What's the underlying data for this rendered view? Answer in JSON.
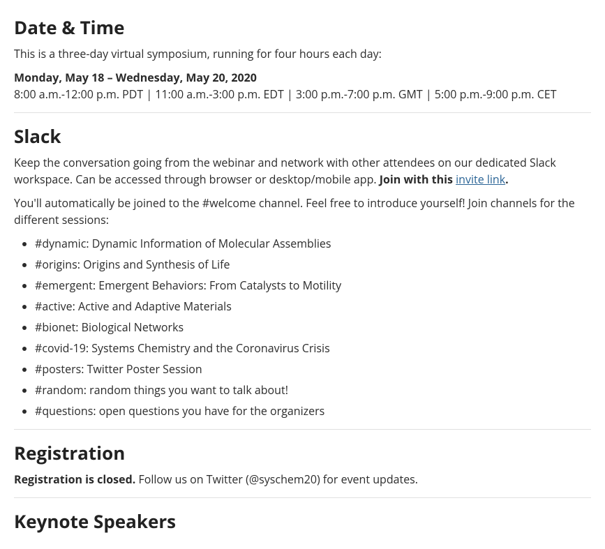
{
  "dateTime": {
    "heading": "Date & Time",
    "intro": "This is a three-day virtual symposium, running for four hours each day:",
    "dates": "Monday, May 18 – Wednesday, May 20, 2020",
    "times": "8:00 a.m.-12:00 p.m. PDT | 11:00 a.m.-3:00 p.m. EDT | 3:00 p.m.-7:00 p.m. GMT | 5:00 p.m.-9:00 p.m. CET"
  },
  "slack": {
    "heading": "Slack",
    "para1a": "Keep the conversation going from the webinar and network with other attendees on our dedicated Slack workspace. Can be accessed through browser or desktop/mobile app. ",
    "para1b": "Join with this ",
    "linkText": "invite link",
    "period": ".",
    "para2": "You'll automatically be joined to the #welcome channel. Feel free to introduce yourself! Join channels for the different sessions:",
    "channels": [
      "#dynamic: Dynamic Information of Molecular Assemblies",
      "#origins: Origins and Synthesis of Life",
      "#emergent: Emergent Behaviors: From Catalysts to Motility",
      "#active: Active and Adaptive Materials",
      "#bionet: Biological Networks",
      "#covid-19: Systems Chemistry and the Coronavirus Crisis",
      "#posters: Twitter Poster Session",
      "#random: random things you want to talk about!",
      "#questions: open questions you have for the organizers"
    ]
  },
  "registration": {
    "heading": "Registration",
    "closed": "Registration is closed.",
    "follow": " Follow us on Twitter (@syschem20) for event updates."
  },
  "keynote": {
    "heading": "Keynote Speakers"
  }
}
